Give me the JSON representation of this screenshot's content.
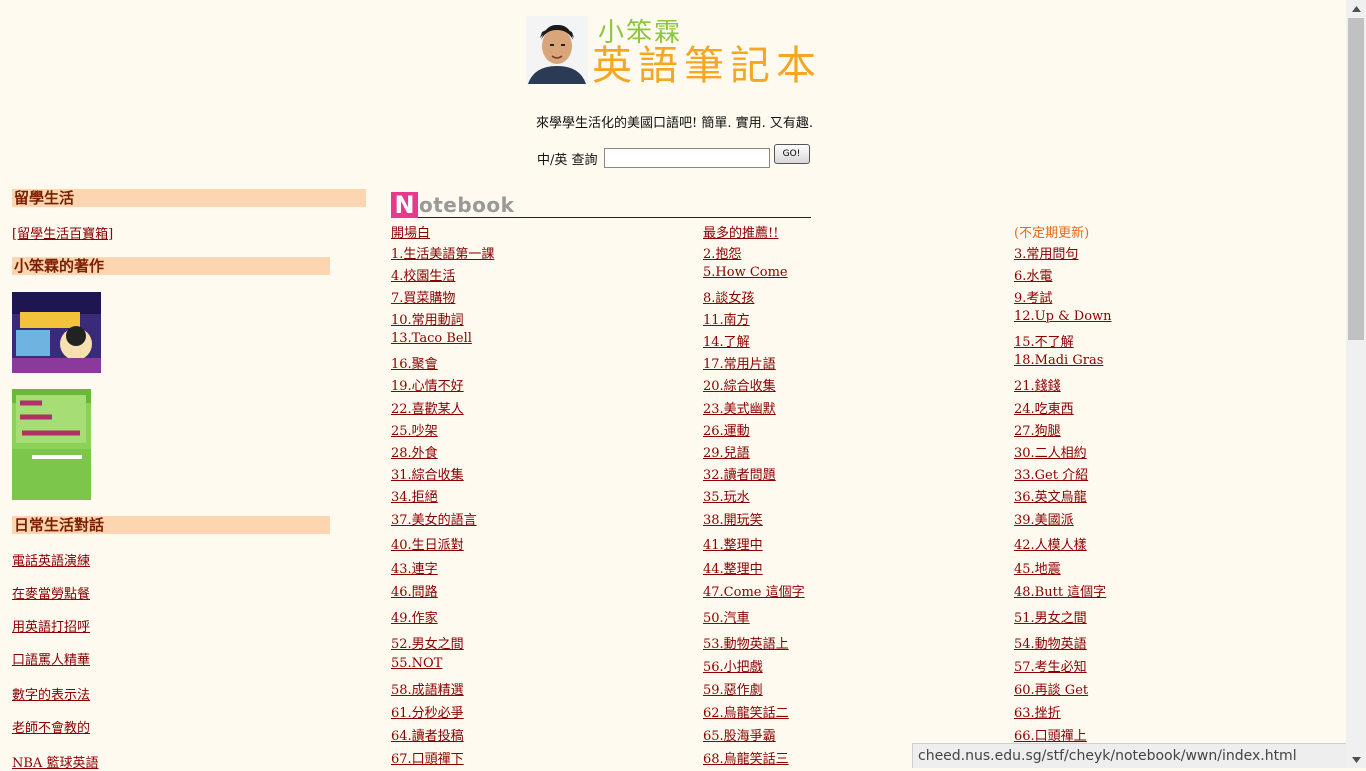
{
  "header": {
    "title_sub": "小笨霖",
    "title_main": "英語筆記本",
    "tagline": "來學學生活化的美國口語吧! 簡單. 實用. 又有趣."
  },
  "search": {
    "label": "中/英 查詢",
    "value": "",
    "button": "GO!"
  },
  "left": {
    "section1": {
      "title": "留學生活",
      "link": "[留學生活百寶箱]"
    },
    "section2": {
      "title": "小笨霖的著作"
    },
    "section3": {
      "title": "日常生活對話",
      "links": [
        "電話英語演練",
        "在麥當勞點餐",
        "用英語打招呼",
        "口語罵人精華",
        "數字的表示法",
        "老師不會教的",
        "NBA 籃球英語"
      ]
    }
  },
  "notebook": {
    "logo_letter": "N",
    "logo_text": "otebook",
    "header_row": [
      "開場白",
      "最多的推薦!!",
      "(不定期更新)"
    ],
    "rows": [
      [
        "1.生活美語第一課",
        "2.抱怨",
        "3.常用問句"
      ],
      [
        "4.校園生活",
        "5.How Come",
        "6.水電"
      ],
      [
        "7.買菜購物",
        "8.談女孩",
        "9.考試"
      ],
      [
        "10.常用動詞",
        "11.南方",
        "12.Up & Down"
      ],
      [
        "13.Taco Bell",
        "14.了解",
        "15.不了解"
      ],
      [
        "16.聚會",
        "17.常用片語",
        "18.Madi Gras"
      ],
      [
        "19.心情不好",
        "20.綜合收集",
        "21.錢錢"
      ],
      [
        "22.喜歡某人",
        "23.美式幽默",
        "24.吃東西"
      ],
      [
        "25.吵架",
        "26.運動",
        "27.狗腿"
      ],
      [
        "28.外食",
        "29.兒語",
        "30.二人相約"
      ],
      [
        "31.綜合收集",
        "32.讀者問題",
        "33.Get 介紹"
      ],
      [
        "34.拒絕",
        "35.玩水",
        "36.英文烏龍"
      ],
      [
        "37.美女的語言",
        "38.開玩笑",
        "39.美國派"
      ],
      [
        "40.生日派對",
        "41.整理中",
        "42.人模人樣"
      ],
      [
        "43.連字",
        "44.整理中",
        "45.地震"
      ],
      [
        "46.問路",
        "47.Come 這個字",
        "48.Butt 這個字"
      ],
      [
        "49.作家",
        "50.汽車",
        "51.男女之間"
      ],
      [
        "52.男女之間",
        "53.動物英語上",
        "54.動物英語"
      ],
      [
        "55.NOT",
        "56.小把戲",
        "57.考生必知"
      ],
      [
        "58.成語精選",
        "59.惡作劇",
        "60.再談 Get"
      ],
      [
        "61.分秒必爭",
        "62.烏龍笑話二",
        "63.挫折"
      ],
      [
        "64.讀者投稿",
        "65.股海爭霸",
        "66.口頭禪上"
      ],
      [
        "67.口頭禪下",
        "68.烏龍笑話三",
        ""
      ]
    ]
  },
  "status_url": "cheed.nus.edu.sg/stf/cheyk/notebook/wwn/index.html",
  "colors": {
    "background": "#fefaf0",
    "section_bg": "#fdd5b0",
    "link": "#8b0000",
    "accent_orange": "#e46a1a",
    "logo_pink": "#e83a8c"
  }
}
